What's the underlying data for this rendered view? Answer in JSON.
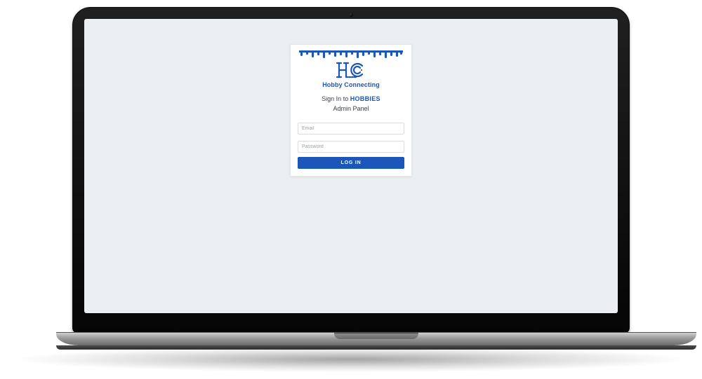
{
  "brand": {
    "name": "Hobby Connecting",
    "accent_color": "#1C56B8"
  },
  "heading": {
    "prefix": "Sign In to ",
    "highlight": "HOBBIES",
    "subtitle": "Admin Panel"
  },
  "form": {
    "email": {
      "placeholder": "Email",
      "value": ""
    },
    "password": {
      "placeholder": "Password",
      "value": ""
    },
    "submit_label": "LOG IN"
  }
}
